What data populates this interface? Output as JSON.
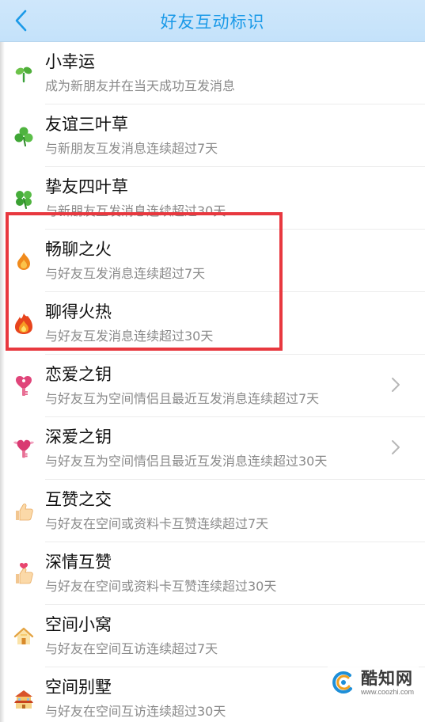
{
  "header": {
    "title": "好友互动标识",
    "back_icon": "chevron-left-icon"
  },
  "items": [
    {
      "title": "小幸运",
      "desc": "成为新朋友并在当天成功互发消息",
      "icon": "sprout-icon",
      "has_arrow": false
    },
    {
      "title": "友谊三叶草",
      "desc": "与新朋友互发消息连续超过7天",
      "icon": "three-leaf-clover-icon",
      "has_arrow": false
    },
    {
      "title": "挚友四叶草",
      "desc": "与新朋友互发消息连续超过30天",
      "icon": "four-leaf-clover-icon",
      "has_arrow": false
    },
    {
      "title": "畅聊之火",
      "desc": "与好友互发消息连续超过7天",
      "icon": "small-fire-icon",
      "has_arrow": false
    },
    {
      "title": "聊得火热",
      "desc": "与好友互发消息连续超过30天",
      "icon": "big-fire-icon",
      "has_arrow": false
    },
    {
      "title": "恋爱之钥",
      "desc": "与好友互为空间情侣且最近互发消息连续超过7天",
      "icon": "heart-lock-icon",
      "has_arrow": true
    },
    {
      "title": "深爱之钥",
      "desc": "与好友互为空间情侣且最近互发消息连续超过30天",
      "icon": "winged-heart-lock-icon",
      "has_arrow": true
    },
    {
      "title": "互赞之交",
      "desc": "与好友在空间或资料卡互赞连续超过7天",
      "icon": "thumbs-up-icon",
      "has_arrow": false
    },
    {
      "title": "深情互赞",
      "desc": "与好友在空间或资料卡互赞连续超过30天",
      "icon": "thumbs-up-heart-icon",
      "has_arrow": false
    },
    {
      "title": "空间小窝",
      "desc": "与好友在空间互访连续超过7天",
      "icon": "small-house-icon",
      "has_arrow": false
    },
    {
      "title": "空间别墅",
      "desc": "与好友在空间互访连续超过30天",
      "icon": "villa-icon",
      "has_arrow": false
    }
  ],
  "watermark": {
    "name": "酷知网",
    "url": "www.coozhi.com",
    "logo_icon": "coozhi-logo-icon"
  },
  "colors": {
    "navbar_bg": "#c7e3fa",
    "title_blue": "#1b9ae8",
    "highlight_red": "#e8383f"
  }
}
